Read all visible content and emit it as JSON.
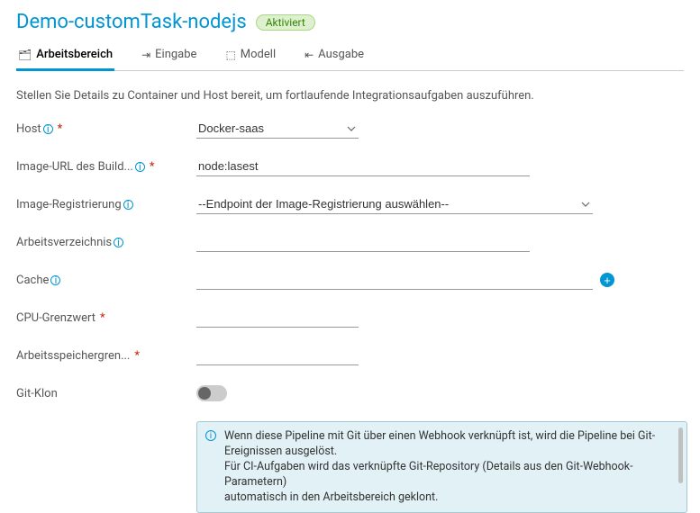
{
  "header": {
    "title": "Demo-customTask-nodejs",
    "status": "Aktiviert"
  },
  "tabs": [
    {
      "label": "Arbeitsbereich",
      "icon": "🗂"
    },
    {
      "label": "Eingabe",
      "icon": "⇥"
    },
    {
      "label": "Modell",
      "icon": "⬚"
    },
    {
      "label": "Ausgabe",
      "icon": "⇤"
    }
  ],
  "intro": "Stellen Sie Details zu Container und Host bereit, um fortlaufende Integrationsaufgaben auszuführen.",
  "fields": {
    "host": {
      "label": "Host",
      "value": "Docker-saas",
      "required": true,
      "info": true
    },
    "image_url": {
      "label": "Image-URL des Build...",
      "value": "node:lasest",
      "required": true,
      "info": true
    },
    "image_reg": {
      "label": "Image-Registrierung",
      "value": "",
      "placeholder": "--Endpoint der Image-Registrierung auswählen--",
      "required": false,
      "info": true
    },
    "workdir": {
      "label": "Arbeitsverzeichnis",
      "value": "",
      "required": false,
      "info": true
    },
    "cache": {
      "label": "Cache",
      "value": "",
      "required": false,
      "info": true
    },
    "cpu_limit": {
      "label": "CPU-Grenzwert",
      "value": "",
      "required": true,
      "info": false
    },
    "mem_limit": {
      "label": "Arbeitsspeichergren...",
      "value": "",
      "required": true,
      "info": false
    },
    "git_clone": {
      "label": "Git-Klon",
      "on": false
    }
  },
  "info_box": {
    "line1": "Wenn diese Pipeline mit Git über einen Webhook verknüpft ist, wird die Pipeline bei Git-Ereignissen ausgelöst.",
    "line2": "Für CI-Aufgaben wird das verknüpfte Git-Repository (Details aus den Git-Webhook-Parametern)",
    "line3": "automatisch in den Arbeitsbereich geklont."
  }
}
